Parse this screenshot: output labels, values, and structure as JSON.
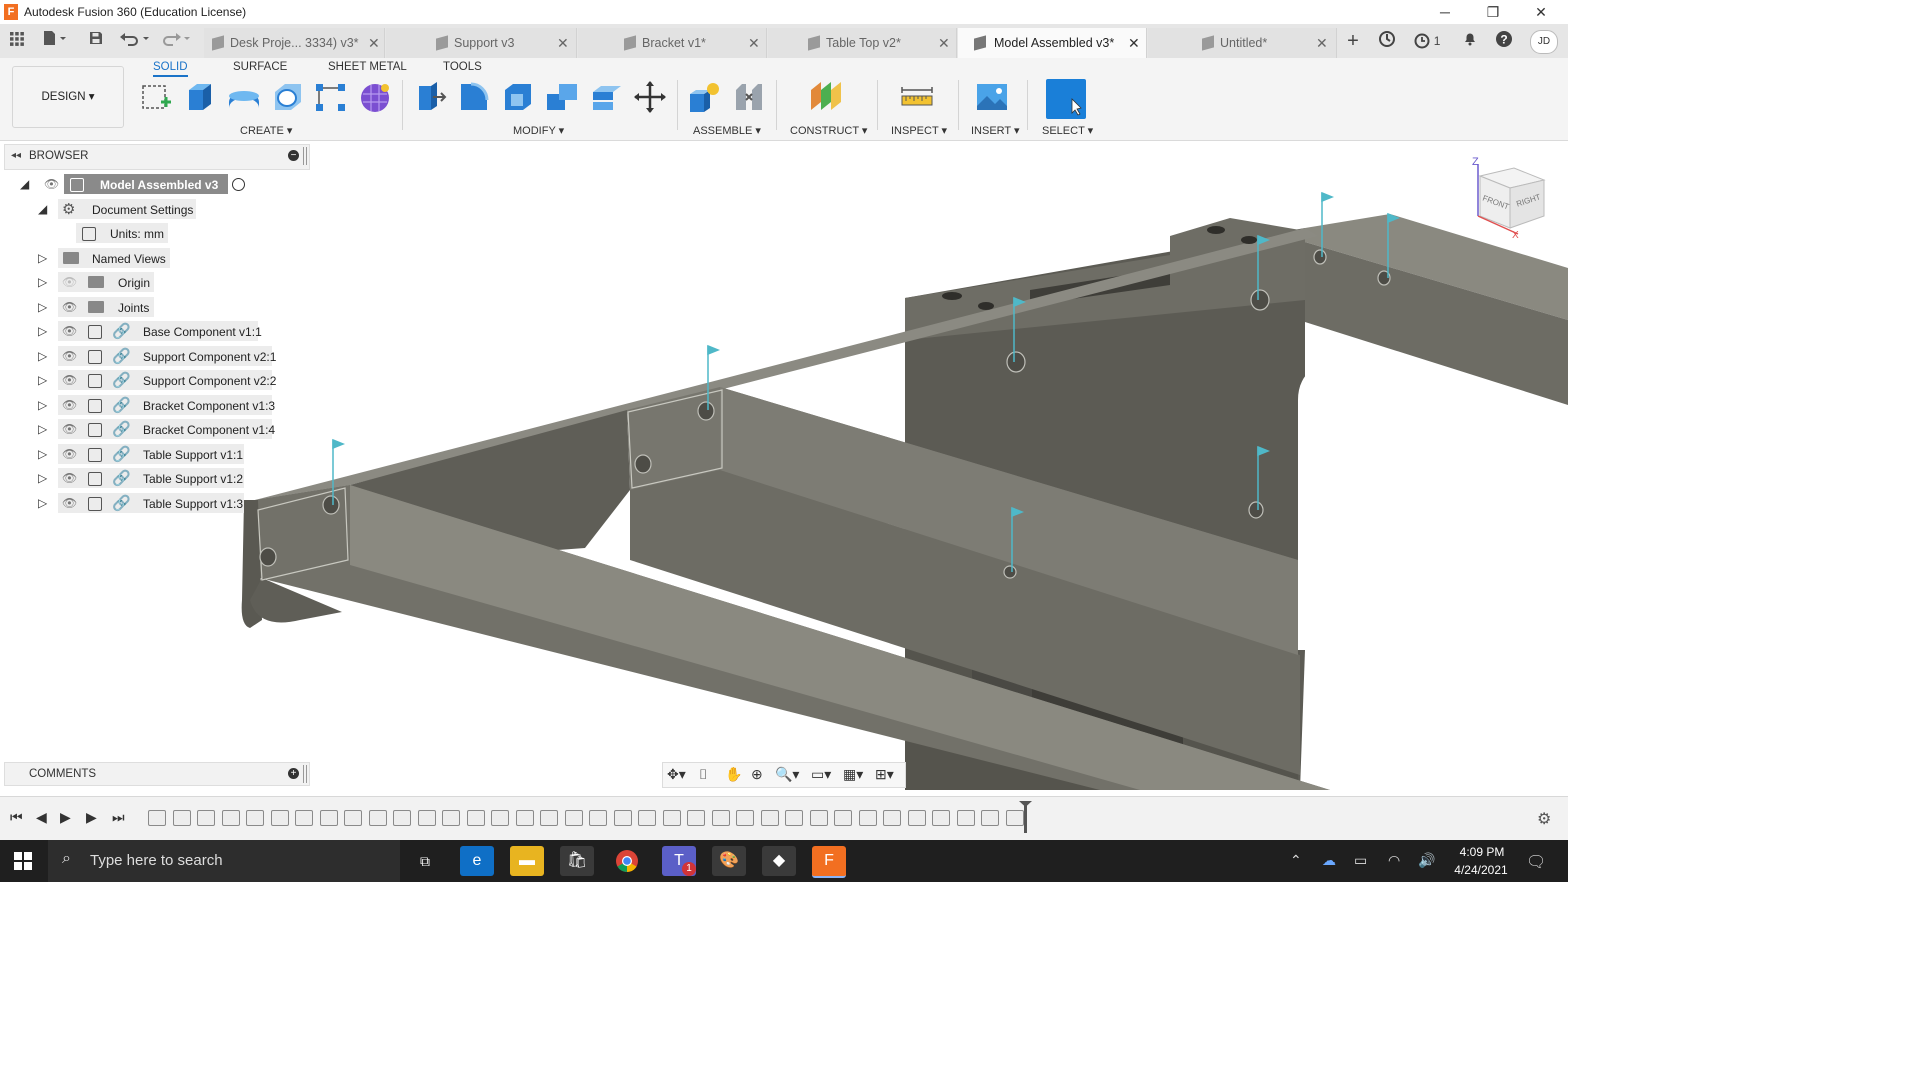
{
  "window": {
    "title": "Autodesk Fusion 360 (Education License)",
    "logo": "F",
    "minimize_icon": "─",
    "restore_icon": "❐",
    "close_icon": "✕"
  },
  "doc_tabs": [
    {
      "label": "Desk Proje... 3334) v3*",
      "active": false
    },
    {
      "label": "Support v3",
      "active": false
    },
    {
      "label": "Bracket v1*",
      "active": false
    },
    {
      "label": "Table Top v2*",
      "active": false
    },
    {
      "label": "Model Assembled v3*",
      "active": true
    },
    {
      "label": "Untitled*",
      "active": false
    }
  ],
  "tab_close_icon": "✕",
  "tab_right": {
    "add_icon": "+",
    "jobs_count": "1",
    "user_initials": "JD"
  },
  "workspace": {
    "label": "DESIGN ▾"
  },
  "toolbar_tabs": [
    {
      "label": "SOLID",
      "active": true
    },
    {
      "label": "SURFACE",
      "active": false
    },
    {
      "label": "SHEET METAL",
      "active": false
    },
    {
      "label": "TOOLS",
      "active": false
    }
  ],
  "toolbar_groups": {
    "create": "CREATE ▾",
    "modify": "MODIFY ▾",
    "assemble": "ASSEMBLE ▾",
    "construct": "CONSTRUCT ▾",
    "inspect": "INSPECT ▾",
    "insert": "INSERT ▾",
    "select": "SELECT ▾"
  },
  "browser": {
    "title": "BROWSER",
    "root": "Model Assembled v3",
    "items": [
      {
        "label": "Document Settings",
        "expanded": true
      },
      {
        "label": "Units: mm"
      },
      {
        "label": "Named Views"
      },
      {
        "label": "Origin"
      },
      {
        "label": "Joints"
      },
      {
        "label": "Base Component v1:1"
      },
      {
        "label": "Support Component v2:1"
      },
      {
        "label": "Support Component v2:2"
      },
      {
        "label": "Bracket Component v1:3"
      },
      {
        "label": "Bracket Component v1:4"
      },
      {
        "label": "Table Support v1:1"
      },
      {
        "label": "Table Support v1:2"
      },
      {
        "label": "Table Support v1:3"
      }
    ]
  },
  "viewcube": {
    "top": "Z",
    "front": "FRONT",
    "right": "RIGHT",
    "axis_x": "X"
  },
  "comments": {
    "title": "COMMENTS"
  },
  "taskbar": {
    "search_placeholder": "Type here to search",
    "time": "4:09 PM",
    "date": "4/24/2021",
    "teams_badge": "1"
  },
  "colors": {
    "accent": "#1a73c8",
    "fusion_orange": "#f26f21",
    "model_gray": "#6b6a62",
    "taskbar": "#1f1f1f"
  }
}
